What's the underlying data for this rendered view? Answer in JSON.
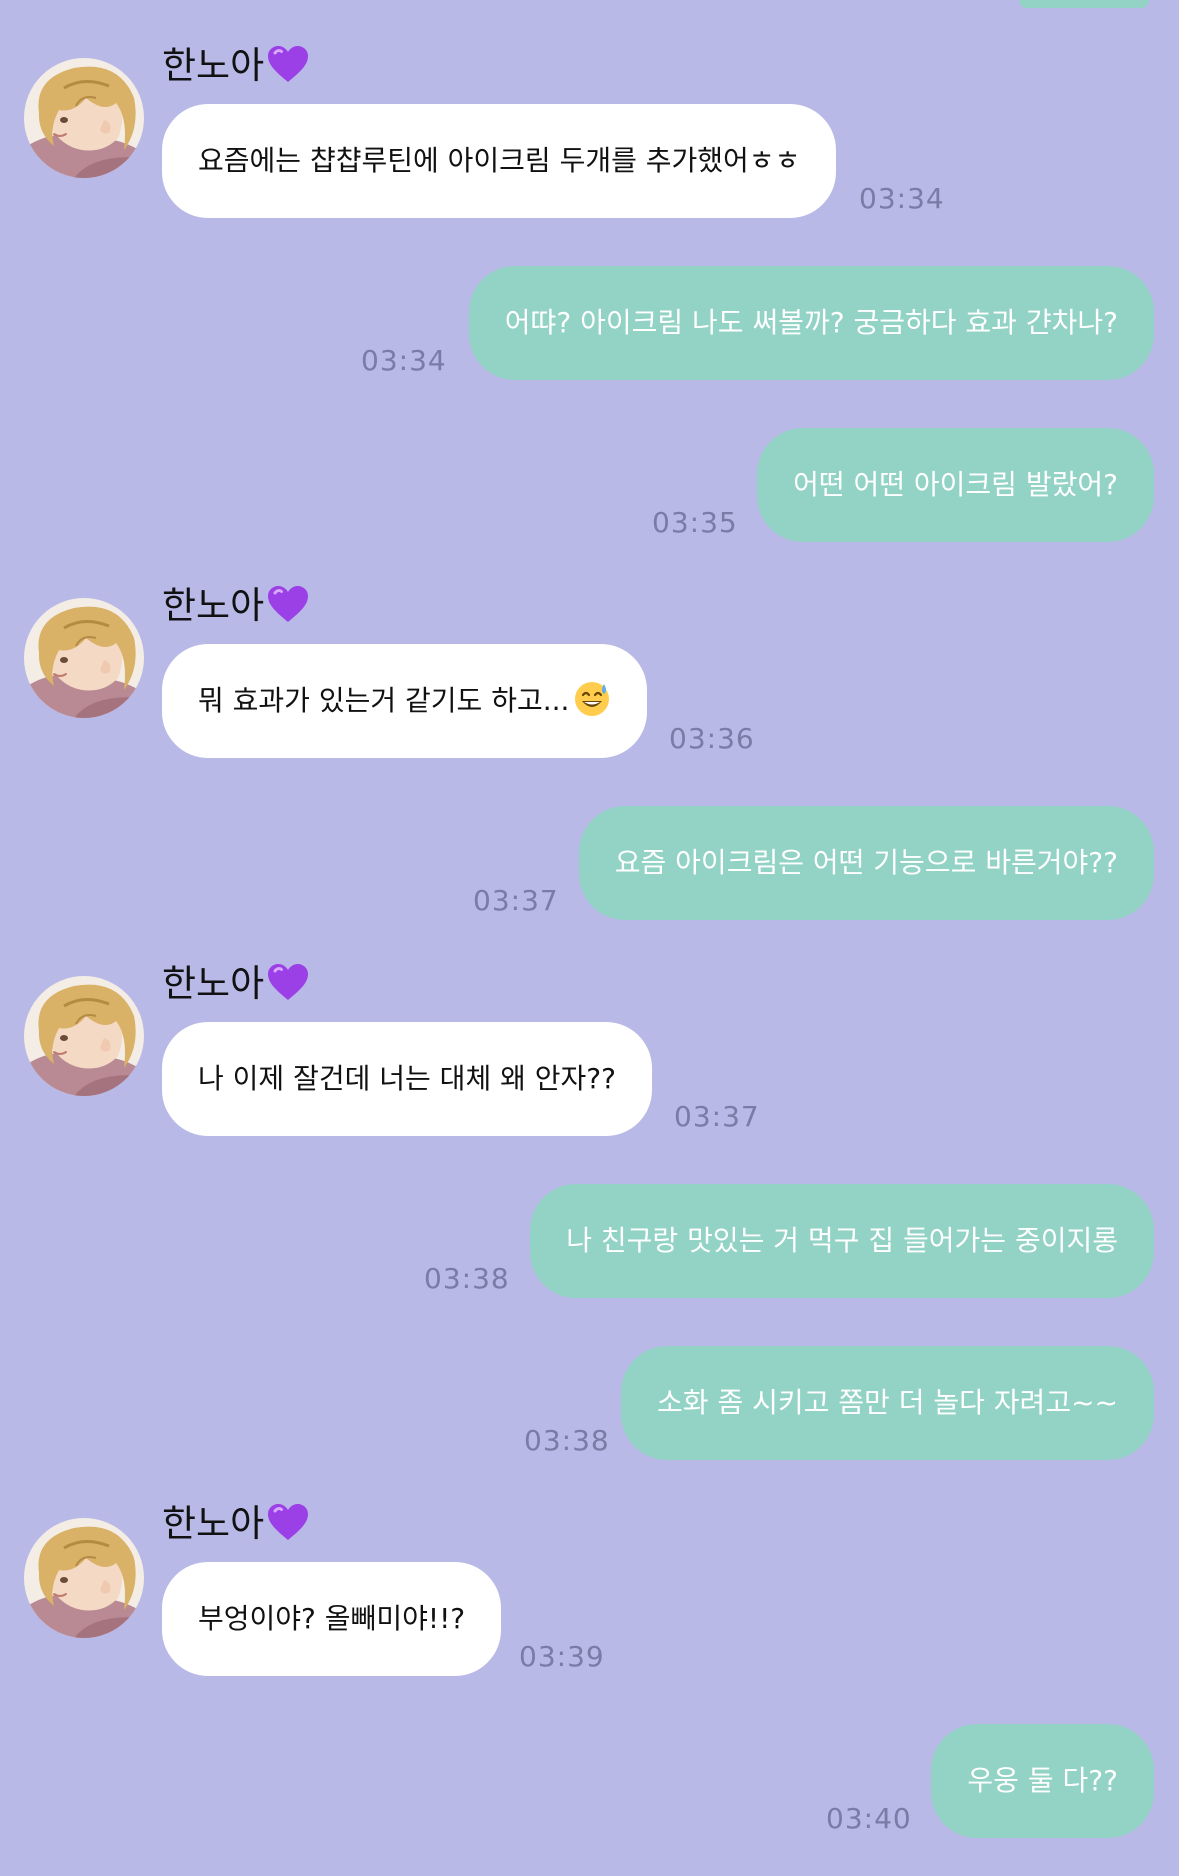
{
  "contact": {
    "name": "한노아",
    "heart_color": "#9b3fe6"
  },
  "colors": {
    "background": "#b8b9e6",
    "incoming_bubble": "#ffffff",
    "outgoing_bubble": "#93d3c6",
    "timestamp": "#7a7ca6"
  },
  "messages": [
    {
      "direction": "in",
      "text": "요즘에는 챱챱루틴에 아이크림 두개를 추가했어ㅎㅎ",
      "time": "03:34"
    },
    {
      "direction": "out",
      "text": "어땨? 아이크림 나도 써볼까? 궁금하다 효과 갼차나?",
      "time": "03:34"
    },
    {
      "direction": "out",
      "text": "어떤 어떤 아이크림 발랐어?",
      "time": "03:35"
    },
    {
      "direction": "in",
      "text": "뭐 효과가 있는거 같기도 하고...",
      "emoji": "sweat-smile-emoji",
      "time": "03:36"
    },
    {
      "direction": "out",
      "text": "요즘 아이크림은 어떤 기능으로 바른거야??",
      "time": "03:37"
    },
    {
      "direction": "in",
      "text": "나 이제 잘건데 너는 대체 왜 안자??",
      "time": "03:37"
    },
    {
      "direction": "out",
      "text": "나 친구랑 맛있는 거 먹구 집 들어가는 중이지롱",
      "time": "03:38"
    },
    {
      "direction": "out",
      "text": "소화 좀 시키고 쫌만 더 놀다 자려고~~",
      "time": "03:38"
    },
    {
      "direction": "in",
      "text": "부엉이야? 올빼미야!!?",
      "time": "03:39"
    },
    {
      "direction": "out",
      "text": "우웅 둘 다??",
      "time": "03:40"
    }
  ]
}
